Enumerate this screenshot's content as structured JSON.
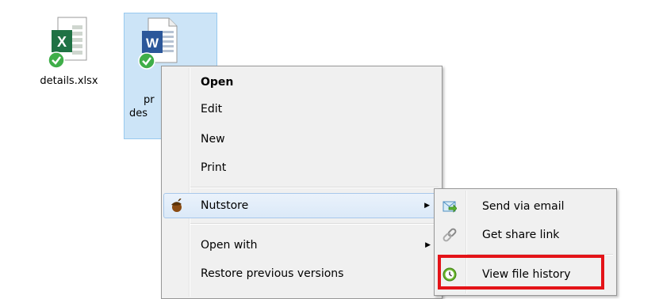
{
  "desktop": {
    "files": [
      {
        "label": "details.xlsx",
        "icon": "excel-file-icon"
      },
      {
        "label_line1": "pr",
        "label_line2": "des",
        "icon": "word-file-icon"
      }
    ]
  },
  "context_menu": {
    "items": [
      {
        "label": "Open",
        "bold": true
      },
      {
        "label": "Edit"
      },
      {
        "label": "New"
      },
      {
        "label": "Print"
      },
      {
        "label": "Nutstore",
        "icon": "acorn-icon",
        "has_submenu": true
      },
      {
        "label": "Open with",
        "has_submenu": true
      },
      {
        "label": "Restore previous versions"
      }
    ],
    "submenu_arrow": "▶"
  },
  "submenu": {
    "items": [
      {
        "label": "Send via email",
        "icon": "email-send-icon"
      },
      {
        "label": "Get share link",
        "icon": "link-icon"
      },
      {
        "label": "View file history",
        "icon": "history-icon"
      }
    ]
  },
  "colors": {
    "highlight_box": "#e41318",
    "selection": "#cce4f7",
    "menu_bg": "#f0f0f0"
  }
}
